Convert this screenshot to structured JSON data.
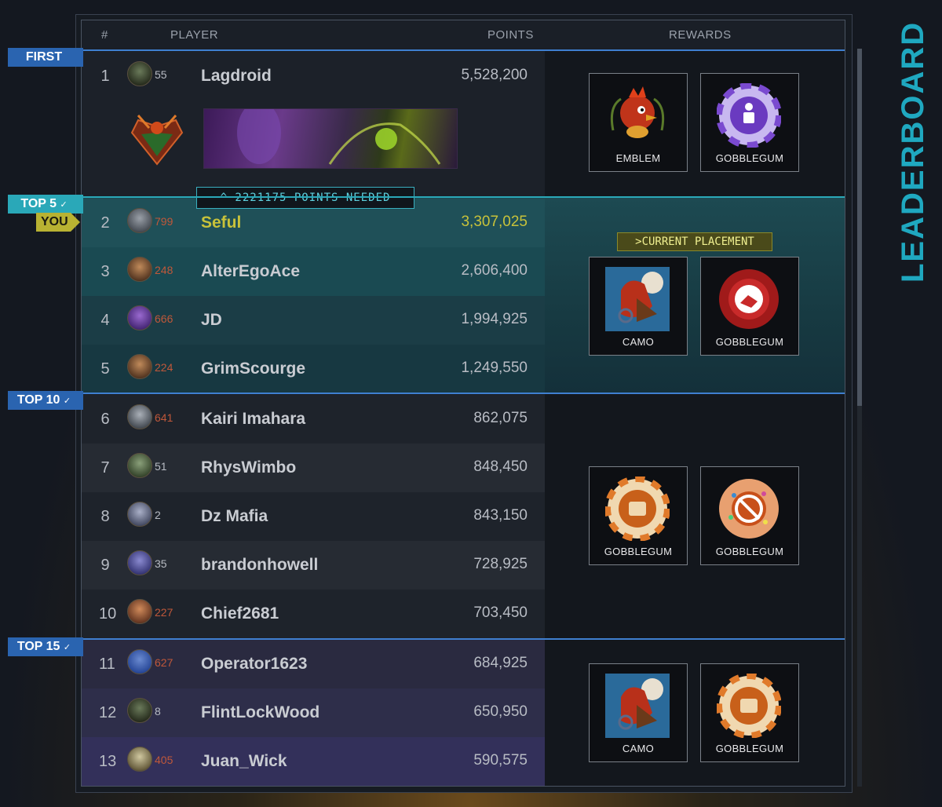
{
  "header": {
    "rank": "#",
    "player": "PLAYER",
    "points": "POINTS",
    "rewards": "REWARDS"
  },
  "side_title": "LEADERBOARD",
  "tiers": [
    {
      "label": "FIRST",
      "check": ""
    },
    {
      "label": "TOP 5",
      "check": "✓"
    },
    {
      "label": "TOP 10",
      "check": "✓"
    },
    {
      "label": "TOP 15",
      "check": "✓"
    }
  ],
  "you_label": "YOU",
  "points_needed": "^ 2221175 POINTS NEEDED",
  "current_placement": ">CURRENT PLACEMENT",
  "rows": [
    {
      "rank": "1",
      "level": "55",
      "name": "Lagdroid",
      "points": "5,528,200"
    },
    {
      "rank": "2",
      "level": "799",
      "name": "Seful",
      "points": "3,307,025"
    },
    {
      "rank": "3",
      "level": "248",
      "name": "AlterEgoAce",
      "points": "2,606,400"
    },
    {
      "rank": "4",
      "level": "666",
      "name": "JD",
      "points": "1,994,925"
    },
    {
      "rank": "5",
      "level": "224",
      "name": "GrimScourge",
      "points": "1,249,550"
    },
    {
      "rank": "6",
      "level": "641",
      "name": "Kairi Imahara",
      "points": "862,075"
    },
    {
      "rank": "7",
      "level": "51",
      "name": "RhysWimbo",
      "points": "848,450"
    },
    {
      "rank": "8",
      "level": "2",
      "name": "Dz Mafia",
      "points": "843,150"
    },
    {
      "rank": "9",
      "level": "35",
      "name": "brandonhowell",
      "points": "728,925"
    },
    {
      "rank": "10",
      "level": "227",
      "name": "Chief2681",
      "points": "703,450"
    },
    {
      "rank": "11",
      "level": "627",
      "name": "Operator1623",
      "points": "684,925"
    },
    {
      "rank": "12",
      "level": "8",
      "name": "FlintLockWood",
      "points": "650,950"
    },
    {
      "rank": "13",
      "level": "405",
      "name": "Juan_Wick",
      "points": "590,575"
    }
  ],
  "rewards": [
    [
      {
        "label": "EMBLEM",
        "icon": "rooster-emblem-icon"
      },
      {
        "label": "GOBBLEGUM",
        "icon": "gobblegum-purple-icon"
      }
    ],
    [
      {
        "label": "CAMO",
        "icon": "rooster-camo-icon"
      },
      {
        "label": "GOBBLEGUM",
        "icon": "gobblegum-red-icon"
      }
    ],
    [
      {
        "label": "GOBBLEGUM",
        "icon": "gobblegum-orange-icon"
      },
      {
        "label": "GOBBLEGUM",
        "icon": "gobblegum-sprinkle-icon"
      }
    ],
    [
      {
        "label": "CAMO",
        "icon": "rooster-camo-icon"
      },
      {
        "label": "GOBBLEGUM",
        "icon": "gobblegum-orange-icon"
      }
    ]
  ],
  "colors": {
    "accent_blue": "#3f7fd0",
    "accent_teal": "#2aa8b8",
    "you_yellow": "#c8c23a",
    "level_red": "#c0583a"
  }
}
